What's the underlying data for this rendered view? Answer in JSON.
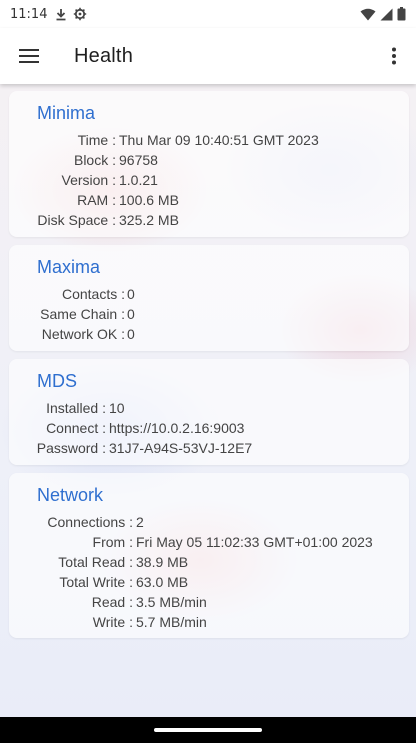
{
  "status_bar": {
    "time": "11:14",
    "icons": [
      "download-icon",
      "settings-gear-icon"
    ],
    "right_icons": [
      "wifi-icon",
      "signal-icon",
      "battery-icon"
    ]
  },
  "app_bar": {
    "title": "Health",
    "menu_icon": "hamburger-menu-icon",
    "more_icon": "more-vertical-icon"
  },
  "accent_color": "#2f6fcf",
  "cards": {
    "minima": {
      "title": "Minima",
      "rows": [
        {
          "label": "Time :",
          "value": "Thu Mar 09 10:40:51 GMT 2023"
        },
        {
          "label": "Block :",
          "value": "96758"
        },
        {
          "label": "Version :",
          "value": "1.0.21"
        },
        {
          "label": "RAM :",
          "value": "100.6 MB"
        },
        {
          "label": "Disk Space :",
          "value": "325.2 MB"
        }
      ]
    },
    "maxima": {
      "title": "Maxima",
      "rows": [
        {
          "label": "Contacts :",
          "value": "0"
        },
        {
          "label": "Same Chain :",
          "value": "0"
        },
        {
          "label": "Network OK :",
          "value": "0"
        }
      ]
    },
    "mds": {
      "title": "MDS",
      "rows": [
        {
          "label": "Installed :",
          "value": "10"
        },
        {
          "label": "Connect :",
          "value": "https://10.0.2.16:9003"
        },
        {
          "label": "Password :",
          "value": "31J7-A94S-53VJ-12E7"
        }
      ]
    },
    "network": {
      "title": "Network",
      "rows": [
        {
          "label": "Connections :",
          "value": "2"
        },
        {
          "label": "From :",
          "value": "Fri May 05 11:02:33 GMT+01:00 2023"
        },
        {
          "label": "Total Read :",
          "value": "38.9 MB"
        },
        {
          "label": "Total Write :",
          "value": "63.0 MB"
        },
        {
          "label": "Read :",
          "value": "3.5 MB/min"
        },
        {
          "label": "Write :",
          "value": "5.7 MB/min"
        }
      ]
    }
  }
}
